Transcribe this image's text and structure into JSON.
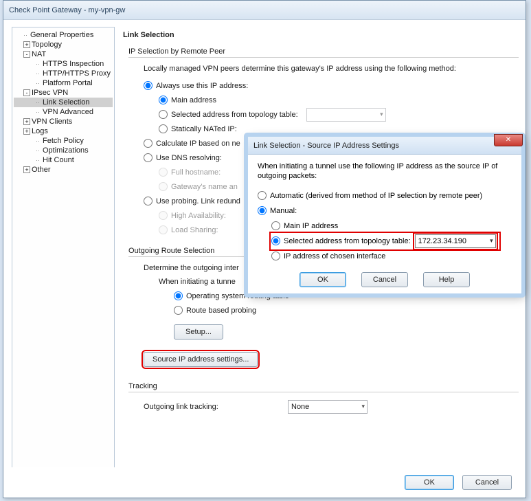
{
  "window": {
    "title": "Check Point Gateway - my-vpn-gw"
  },
  "tree": {
    "items": [
      {
        "label": "General Properties",
        "expander": null,
        "level": 0
      },
      {
        "label": "Topology",
        "expander": "+",
        "level": 0
      },
      {
        "label": "NAT",
        "expander": "-",
        "level": 0
      },
      {
        "label": "HTTPS Inspection",
        "expander": null,
        "level": 1
      },
      {
        "label": "HTTP/HTTPS Proxy",
        "expander": null,
        "level": 1
      },
      {
        "label": "Platform Portal",
        "expander": null,
        "level": 1
      },
      {
        "label": "IPsec VPN",
        "expander": "-",
        "level": 0
      },
      {
        "label": "Link Selection",
        "expander": null,
        "level": 1,
        "selected": true
      },
      {
        "label": "VPN Advanced",
        "expander": null,
        "level": 1
      },
      {
        "label": "VPN Clients",
        "expander": "+",
        "level": 0
      },
      {
        "label": "Logs",
        "expander": "+",
        "level": 0
      },
      {
        "label": "Fetch Policy",
        "expander": null,
        "level": 1
      },
      {
        "label": "Optimizations",
        "expander": null,
        "level": 1
      },
      {
        "label": "Hit Count",
        "expander": null,
        "level": 1
      },
      {
        "label": "Other",
        "expander": "+",
        "level": 0
      }
    ]
  },
  "main": {
    "heading": "Link Selection",
    "ip_selection_label": "IP Selection by Remote Peer",
    "locally_managed": "Locally managed VPN peers determine this gateway's IP address using the following method:",
    "always_use": "Always use this IP address:",
    "main_address": "Main address",
    "selected_from_topo": "Selected address from topology table:",
    "statically_nated": "Statically NATed IP:",
    "calc_ip": "Calculate IP based on ne",
    "use_dns": "Use DNS resolving:",
    "full_hostname": "Full hostname:",
    "gw_name": "Gateway's name an",
    "use_probing": "Use probing. Link redund",
    "high_avail": "High Availability:",
    "load_sharing": "Load Sharing:",
    "outgoing_heading": "Outgoing Route Selection",
    "determine_outgoing": "Determine the outgoing inter",
    "when_initiating": "When initiating a tunne",
    "os_routing": "Operating system routing table",
    "route_based": "Route based probing",
    "setup_btn": "Setup...",
    "source_ip_btn": "Source IP address settings...",
    "tracking_heading": "Tracking",
    "outgoing_link_tracking": "Outgoing link tracking:",
    "tracking_value": "None"
  },
  "modal": {
    "title": "Link Selection - Source IP Address Settings",
    "intro": "When initiating a tunnel use the following IP address as the source IP of outgoing packets:",
    "automatic": "Automatic (derived from method of IP selection by remote peer)",
    "manual": "Manual:",
    "main_ip": "Main IP address",
    "selected_topo": "Selected address from topology table:",
    "chosen_iface": "IP address of chosen interface",
    "ip_value": "172.23.34.190",
    "ok": "OK",
    "cancel": "Cancel",
    "help": "Help"
  },
  "footer": {
    "ok": "OK",
    "cancel": "Cancel"
  }
}
